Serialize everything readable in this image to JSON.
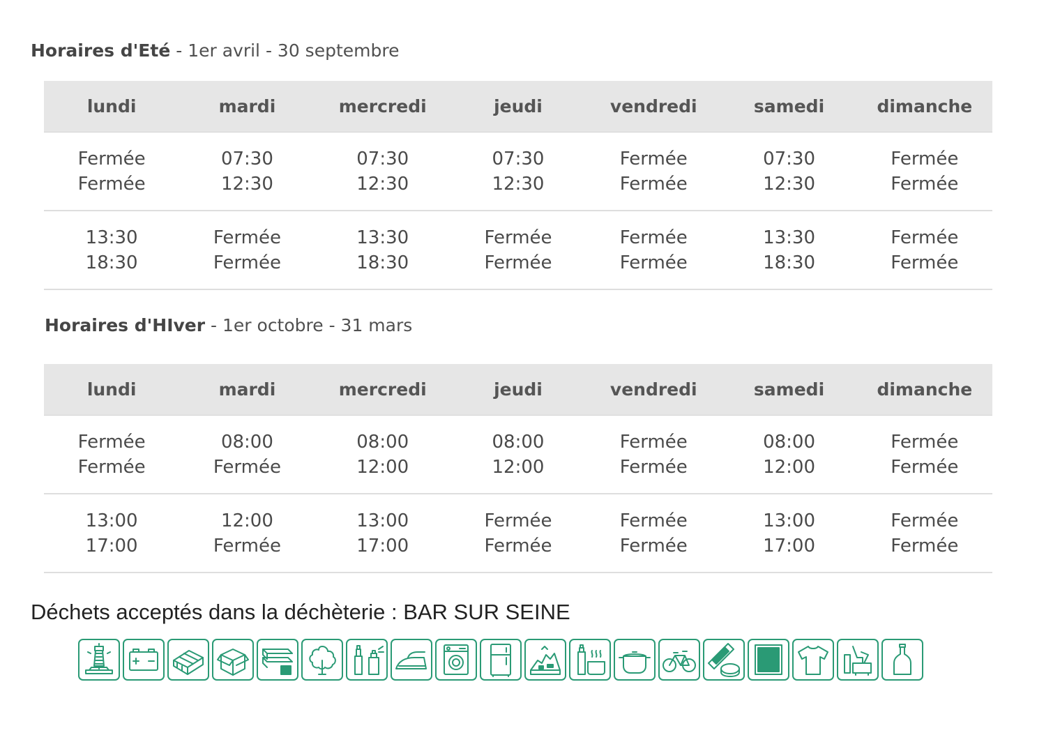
{
  "days": [
    "lundi",
    "mardi",
    "mercredi",
    "jeudi",
    "vendredi",
    "samedi",
    "dimanche"
  ],
  "summer": {
    "title": "Horaires d'Eté",
    "period": " - 1er avril - 30 septembre",
    "rows": [
      [
        [
          "Fermée",
          "Fermée"
        ],
        [
          "07:30",
          "12:30"
        ],
        [
          "07:30",
          "12:30"
        ],
        [
          "07:30",
          "12:30"
        ],
        [
          "Fermée",
          "Fermée"
        ],
        [
          "07:30",
          "12:30"
        ],
        [
          "Fermée",
          "Fermée"
        ]
      ],
      [
        [
          "13:30",
          "18:30"
        ],
        [
          "Fermée",
          "Fermée"
        ],
        [
          "13:30",
          "18:30"
        ],
        [
          "Fermée",
          "Fermée"
        ],
        [
          "Fermée",
          "Fermée"
        ],
        [
          "13:30",
          "18:30"
        ],
        [
          "Fermée",
          "Fermée"
        ]
      ]
    ]
  },
  "winter": {
    "title": "Horaires d'HIver",
    "period": " - 1er octobre - 31 mars",
    "rows": [
      [
        [
          "Fermée",
          "Fermée"
        ],
        [
          "08:00",
          "Fermée"
        ],
        [
          "08:00",
          "12:00"
        ],
        [
          "08:00",
          "12:00"
        ],
        [
          "Fermée",
          "Fermée"
        ],
        [
          "08:00",
          "12:00"
        ],
        [
          "Fermée",
          "Fermée"
        ]
      ],
      [
        [
          "13:00",
          "17:00"
        ],
        [
          "12:00",
          "Fermée"
        ],
        [
          "13:00",
          "17:00"
        ],
        [
          "Fermée",
          "Fermée"
        ],
        [
          "Fermée",
          "Fermée"
        ],
        [
          "13:00",
          "17:00"
        ],
        [
          "Fermée",
          "Fermée"
        ]
      ]
    ]
  },
  "waste": {
    "title": "Déchets acceptés dans la déchèterie : BAR SUR SEINE",
    "accent_color": "#2a9a75",
    "icons": [
      "lamp-icon",
      "battery-icon",
      "pallet-icon",
      "cardboard-icon",
      "wood-icon",
      "green-waste-icon",
      "paint-icon",
      "iron-icon",
      "washing-machine-icon",
      "fridge-icon",
      "rubble-icon",
      "oil-icon",
      "pot-icon",
      "bicycle-icon",
      "hazardous-icon",
      "xray-icon",
      "textile-icon",
      "furniture-icon",
      "glass-bottle-icon"
    ]
  }
}
